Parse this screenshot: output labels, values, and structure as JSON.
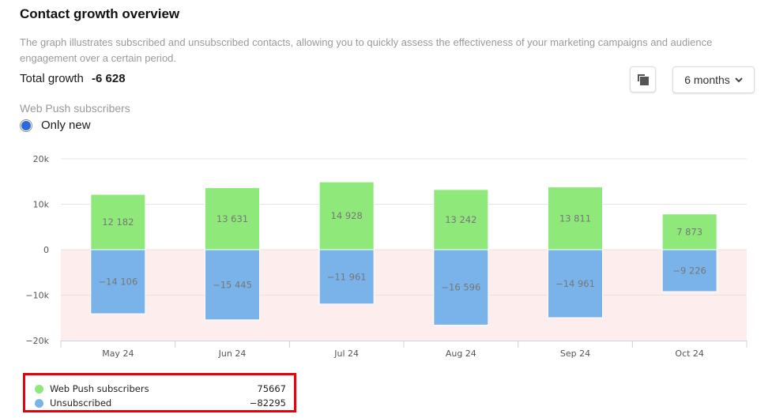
{
  "header": {
    "title": "Contact growth overview",
    "description": "The graph illustrates subscribed and unsubscribed contacts, allowing you to quickly assess the effectiveness of your marketing campaigns and audience engagement over a certain period.",
    "total_growth_label": "Total growth",
    "total_growth_value": "-6 628"
  },
  "toolbar": {
    "copy_icon": "copy-icon",
    "period_label": "6 months",
    "period_icon": "chevron-down-icon"
  },
  "filter": {
    "section_label": "Web Push subscribers",
    "radio_label": "Only new",
    "radio_selected": true
  },
  "legend": {
    "items": [
      {
        "name": "Web Push subscribers",
        "total": "75667",
        "color": "#8fe87a"
      },
      {
        "name": "Unsubscribed",
        "total": "−82295",
        "color": "#7ab3ea"
      }
    ]
  },
  "chart_data": {
    "type": "bar",
    "stacked": true,
    "title": "",
    "xlabel": "",
    "ylabel": "",
    "categories": [
      "May 24",
      "Jun 24",
      "Jul 24",
      "Aug 24",
      "Sep 24",
      "Oct 24"
    ],
    "series": [
      {
        "name": "Web Push subscribers",
        "color": "#8fe87a",
        "values": [
          12182,
          13631,
          14928,
          13242,
          13811,
          7873
        ],
        "labels": [
          "12 182",
          "13 631",
          "14 928",
          "13 242",
          "13 811",
          "7 873"
        ]
      },
      {
        "name": "Unsubscribed",
        "color": "#7ab3ea",
        "values": [
          -14106,
          -15445,
          -11961,
          -16596,
          -14961,
          -9226
        ],
        "labels": [
          "−14 106",
          "−15 445",
          "−11 961",
          "−16 596",
          "−14 961",
          "−9 226"
        ]
      }
    ],
    "ylim": [
      -20000,
      20000
    ],
    "yticks": [
      20000,
      10000,
      0,
      -10000,
      -20000
    ],
    "ytick_labels": [
      "20k",
      "10k",
      "0",
      "−10k",
      "−20k"
    ],
    "negative_region_color": "#fdeeed",
    "grid": true,
    "legend_position": "bottom-left"
  }
}
